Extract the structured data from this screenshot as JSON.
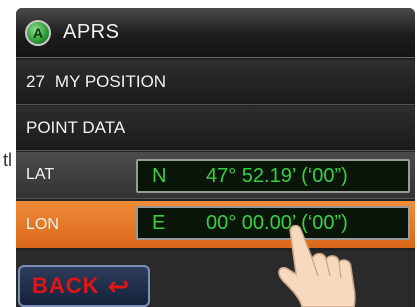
{
  "background_fragment": "tl",
  "header": {
    "title": "APRS",
    "icon": "aprs-a-icon",
    "icon_letter": "A"
  },
  "menu": [
    {
      "number": "27",
      "label": "MY POSITION"
    },
    {
      "label": "POINT DATA"
    }
  ],
  "fields": {
    "lat": {
      "label": "LAT",
      "hemisphere": "N",
      "value": "47° 52.19’ (‘00”)"
    },
    "lon": {
      "label": "LON",
      "hemisphere": "E",
      "value": "00° 00.00’ (‘00”)"
    }
  },
  "back_button": {
    "label": "BACK",
    "icon": "return-arrow-icon"
  },
  "colors": {
    "accent_orange": "#e07020",
    "display_green": "#35d040",
    "back_red": "#e01515",
    "screen_dark": "#222222"
  },
  "overlay": {
    "icon": "pointing-hand-icon"
  }
}
